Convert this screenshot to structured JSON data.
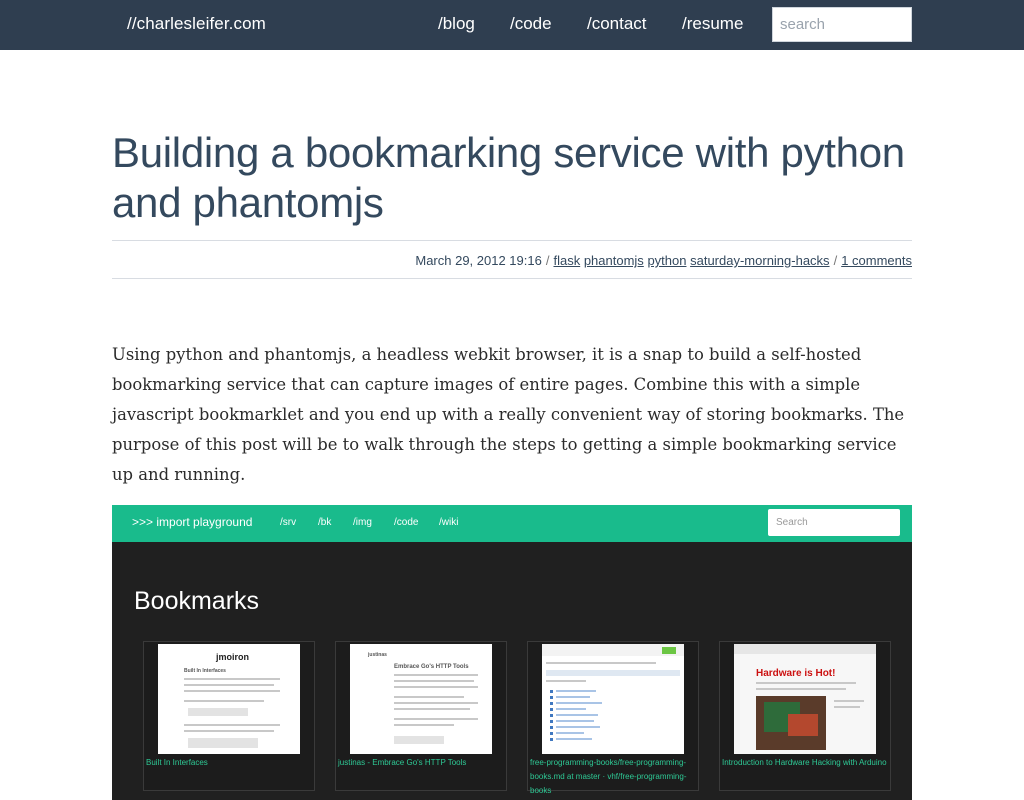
{
  "header": {
    "brand": "//charlesleifer.com",
    "nav": [
      "/blog",
      "/code",
      "/contact",
      "/resume"
    ],
    "search_placeholder": "search"
  },
  "post": {
    "title": "Building a bookmarking service with python and phantomjs",
    "date": "March 29, 2012 19:16",
    "separator": "/",
    "tags": [
      "flask",
      "phantomjs",
      "python",
      "saturday-morning-hacks"
    ],
    "comments": "1 comments",
    "intro": "Using python and phantomjs, a headless webkit browser, it is a snap to build a self-hosted bookmarking service that can capture images of entire pages. Combine this with a simple javascript bookmarklet and you end up with a really convenient way of storing bookmarks. The purpose of this post will be to walk through the steps to getting a simple bookmarking service up and running."
  },
  "screenshot": {
    "brand": ">>> import playground",
    "nav": [
      "/srv",
      "/bk",
      "/img",
      "/code",
      "/wiki"
    ],
    "search_placeholder": "Search",
    "heading": "Bookmarks",
    "cards": [
      {
        "caption": "Built In Interfaces",
        "thumb_title": "jmoiron",
        "thumb_subtitle": "Built In Interfaces"
      },
      {
        "caption": "justinas - Embrace Go's HTTP Tools",
        "thumb_title": "justinas",
        "thumb_subtitle": "Embrace Go's HTTP Tools"
      },
      {
        "caption": "free-programming-books/free-programming-books.md at master · vhf/free-programming-books"
      },
      {
        "caption": "Introduction to Hardware Hacking with Arduino",
        "thumb_title": "Hardware is Hot!"
      }
    ]
  },
  "colors": {
    "nav_bg": "#2f3e50",
    "screenshot_nav_bg": "#19bb8c",
    "screenshot_bg": "#202020",
    "caption_green": "#2ec995"
  }
}
